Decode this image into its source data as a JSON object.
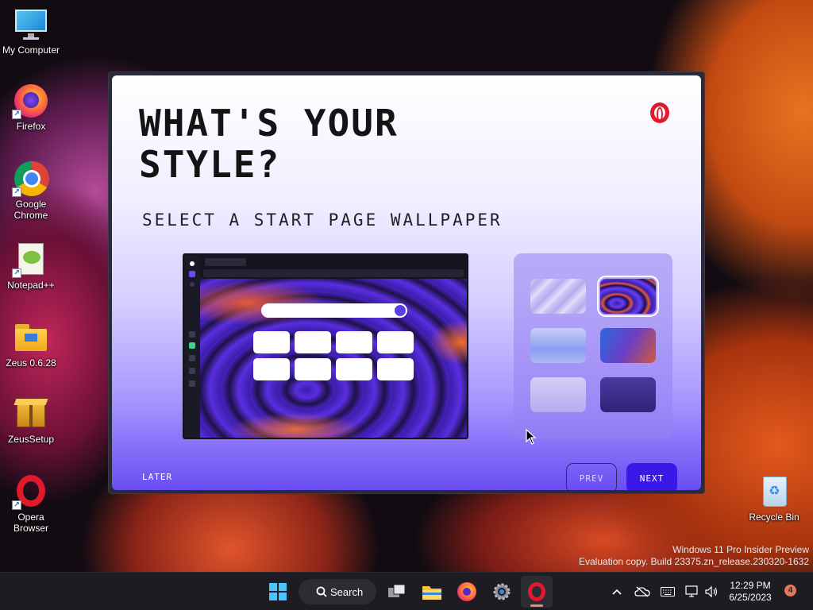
{
  "desktop": {
    "icons": [
      {
        "label": "My Computer"
      },
      {
        "label": "Firefox"
      },
      {
        "label": "Google Chrome"
      },
      {
        "label": "Notepad++"
      },
      {
        "label": "Zeus 0.6.28"
      },
      {
        "label": "ZeusSetup"
      },
      {
        "label": "Opera Browser"
      },
      {
        "label": "Recycle Bin"
      }
    ]
  },
  "dialog": {
    "headline": "WHAT'S YOUR STYLE?",
    "subheading": "SELECT A START PAGE WALLPAPER",
    "later_label": "LATER",
    "prev_label": "PREV",
    "next_label": "NEXT",
    "selected_wallpaper_index": 1,
    "wallpapers": [
      {
        "icon": "wallpaper-light-lilac",
        "color": "#c8c0f0"
      },
      {
        "icon": "wallpaper-purple-swirl",
        "color": "#3a1eb0"
      },
      {
        "icon": "wallpaper-soft-blue",
        "color": "#9aa8ef"
      },
      {
        "icon": "wallpaper-blue-orange",
        "color": "#6a3ec6"
      },
      {
        "icon": "wallpaper-pale-lavender",
        "color": "#c5b8f2"
      },
      {
        "icon": "wallpaper-dark-indigo",
        "color": "#3a2c8c"
      }
    ]
  },
  "watermark": {
    "line1": "Windows 11 Pro Insider Preview",
    "line2": "Evaluation copy. Build 23375.zn_release.230320-1632"
  },
  "taskbar": {
    "search_label": "Search",
    "time": "12:29 PM",
    "date": "6/25/2023",
    "notification_count": "4"
  },
  "colors": {
    "accent": "#3c18e8",
    "opera_red": "#e0192c"
  }
}
